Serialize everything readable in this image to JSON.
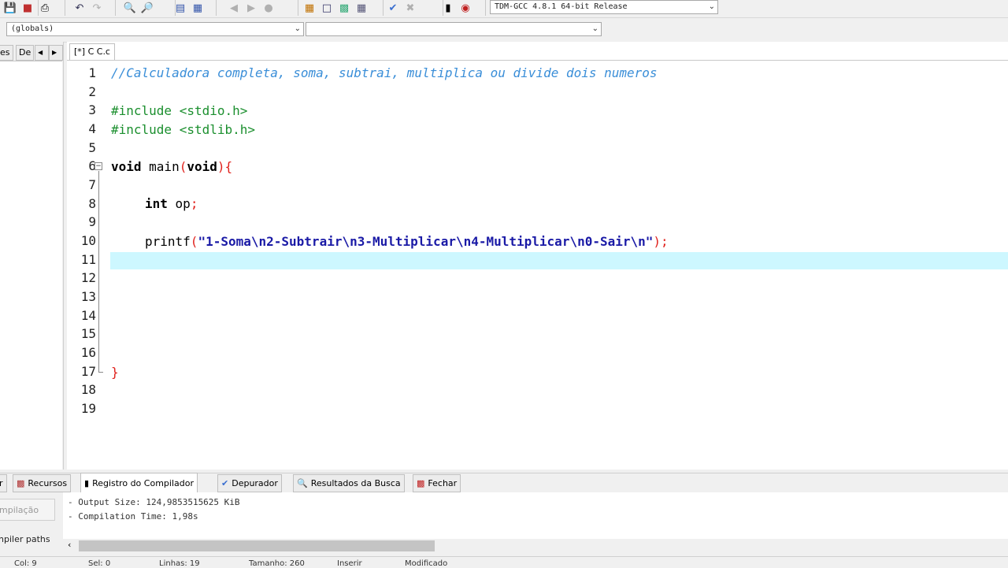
{
  "toolbar": {
    "compiler_select": "TDM-GCC 4.8.1 64-bit Release",
    "icons": [
      "save-icon",
      "close-icon",
      "print-icon",
      "undo-icon",
      "redo-icon",
      "search-icon",
      "replace-icon",
      "indent-icon",
      "unindent-icon",
      "back-icon",
      "forward-icon",
      "stop-icon",
      "new-class-icon",
      "new-file-icon",
      "insert-icon",
      "toggle-icon",
      "check-icon",
      "delete-icon",
      "chart-icon",
      "debug-icon"
    ]
  },
  "scope_bar": {
    "scope_select": "(globals)",
    "member_select": ""
  },
  "left_panel": {
    "tabs": [
      "es",
      "De"
    ]
  },
  "editor": {
    "tab_label": "[*] C C.c",
    "line_numbers": [
      "1",
      "2",
      "3",
      "4",
      "5",
      "6",
      "7",
      "8",
      "9",
      "10",
      "11",
      "12",
      "13",
      "14",
      "15",
      "16",
      "17",
      "18",
      "19"
    ],
    "code": {
      "l1": "//Calculadora completa, soma, subtrai, multiplica ou divide dois numeros",
      "l3": "#include <stdio.h>",
      "l4": "#include <stdlib.h>",
      "l6_kw": "void",
      "l6_name": " main",
      "l6_paren_open": "(",
      "l6_arg": "void",
      "l6_paren_close": ")",
      "l6_brace": "{",
      "l8_kw": "int",
      "l8_rest": " op",
      "l8_semi": ";",
      "l10_fn": "printf",
      "l10_open": "(",
      "l10_str": "\"1-Soma\\n2-Subtrair\\n3-Multiplicar\\n4-Multiplicar\\n0-Sair\\n\"",
      "l10_close": ");",
      "l17_brace": "}"
    }
  },
  "bottom_tabs": [
    "r",
    "Recursos",
    "Registro do Compilador",
    "Depurador",
    "Resultados da Busca",
    "Fechar"
  ],
  "bottom_panel": {
    "side_buttons": [
      "mpilação",
      "npiler paths"
    ],
    "log": [
      "- Output Size: 124,9853515625 KiB",
      "- Compilation Time: 1,98s"
    ]
  },
  "status_bar": {
    "items": [
      "Col:  9",
      "Sel:  0",
      "Linhas:  19",
      "Tamanho:  260",
      "Inserir",
      "Modificado"
    ]
  }
}
